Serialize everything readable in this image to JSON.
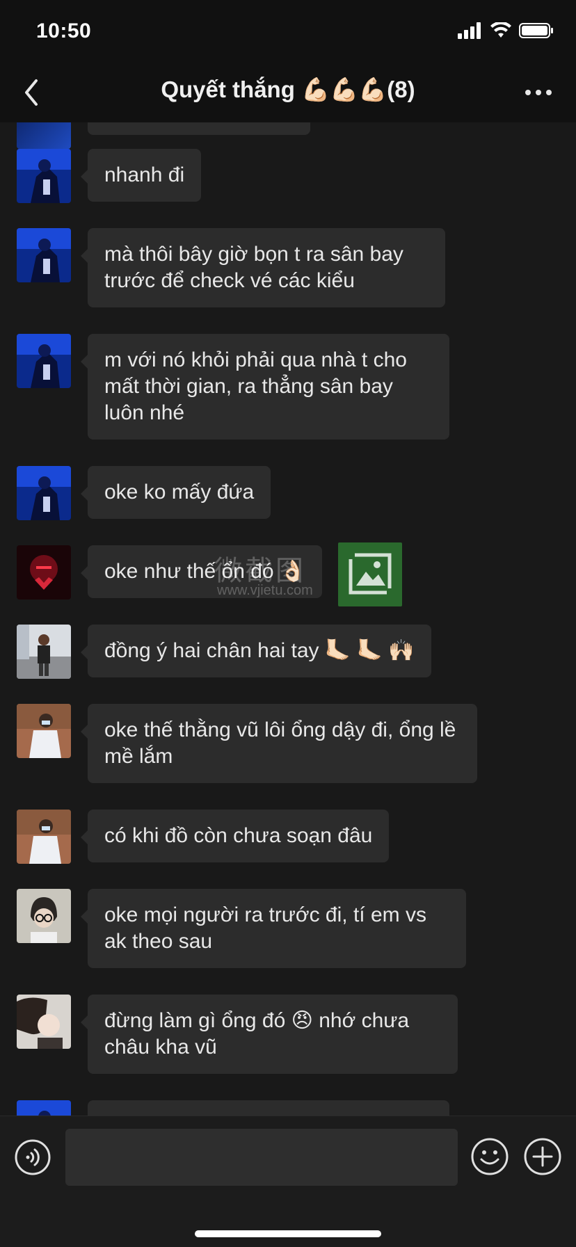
{
  "status": {
    "time": "10:50"
  },
  "header": {
    "title": "Quyết thắng 💪🏻💪🏻💪🏻(8)"
  },
  "messages": [
    {
      "avatar": "avatar-blue",
      "text": "nhanh đi"
    },
    {
      "avatar": "avatar-blue",
      "text": "mà thôi bây giờ bọn t ra sân bay trước để check vé các kiểu"
    },
    {
      "avatar": "avatar-blue",
      "text": "m với nó khỏi phải qua nhà t cho mất thời gian, ra thẳng sân bay luôn nhé"
    },
    {
      "avatar": "avatar-blue",
      "text": "oke ko mấy đứa"
    },
    {
      "avatar": "avatar-red",
      "text": "oke như thế ổn đó 👌🏻"
    },
    {
      "avatar": "avatar-street",
      "text": "đồng ý hai chân hai tay 🦶🏻 🦶🏻 🙌🏻"
    },
    {
      "avatar": "avatar-white",
      "text": "oke thế thằng vũ lôi ổng dậy đi, ổng lề mề lắm"
    },
    {
      "avatar": "avatar-white",
      "text": "có khi đồ còn chưa soạn đâu"
    },
    {
      "avatar": "avatar-glasses",
      "text": "oke mọi người ra trước đi, tí em vs ak theo sau"
    },
    {
      "avatar": "avatar-girl",
      "text": "đừng làm gì ổng đó 😠 nhớ chưa châu kha vũ"
    }
  ],
  "watermark": {
    "text": "微截图",
    "url": "www.vjietu.com"
  },
  "input": {
    "placeholder": ""
  }
}
